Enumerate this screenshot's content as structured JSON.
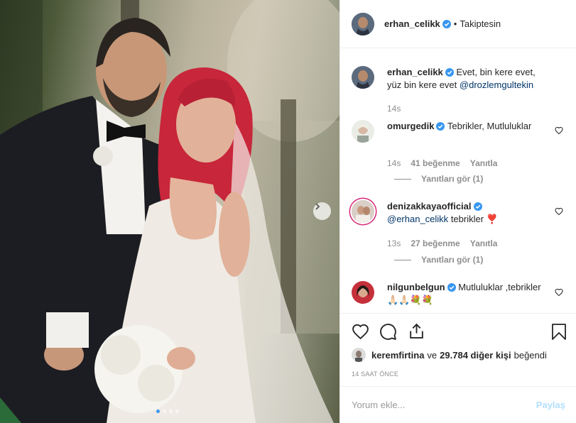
{
  "header": {
    "username": "erhan_celikk",
    "separator": "•",
    "follow_status": "Takiptesin"
  },
  "caption": {
    "username": "erhan_celikk",
    "text": "Evet, bin kere evet, yüz bin kere evet",
    "emoji": "  ",
    "mention": "@drozlemgultekin",
    "time": "14s"
  },
  "comments": [
    {
      "username": "omurgedik",
      "text": "Tebrikler, Mutluluklar",
      "emoji": "",
      "time": "14s",
      "likes": "41 beğenme",
      "reply": "Yanıtla",
      "view_replies": "Yanıtları gör (1)"
    },
    {
      "username": "denizakkayaofficial",
      "mention": "@erhan_celikk",
      "text": "tebrikler",
      "emoji": "❣️",
      "time": "13s",
      "likes": "27 beğenme",
      "reply": "Yanıtla",
      "view_replies": "Yanıtları gör (1)"
    },
    {
      "username": "nilgunbelgun",
      "text": "Mutluluklar ,tebrikler",
      "emoji": "🙏🏻🙏🏻💐💐"
    }
  ],
  "likes": {
    "user": "keremfirtina",
    "connector": "ve",
    "count": "29.784 diğer kişi",
    "suffix": "beğendi"
  },
  "timestamp": "14 SAAT ÖNCE",
  "add_comment": {
    "placeholder": "Yorum ekle...",
    "post_label": "Paylaş"
  },
  "colors": {
    "verified": "#3897f0",
    "link": "#003569",
    "post_disabled": "#b2dffc",
    "ring": "#d62976"
  },
  "carousel": {
    "slides": 4,
    "active": 1
  }
}
